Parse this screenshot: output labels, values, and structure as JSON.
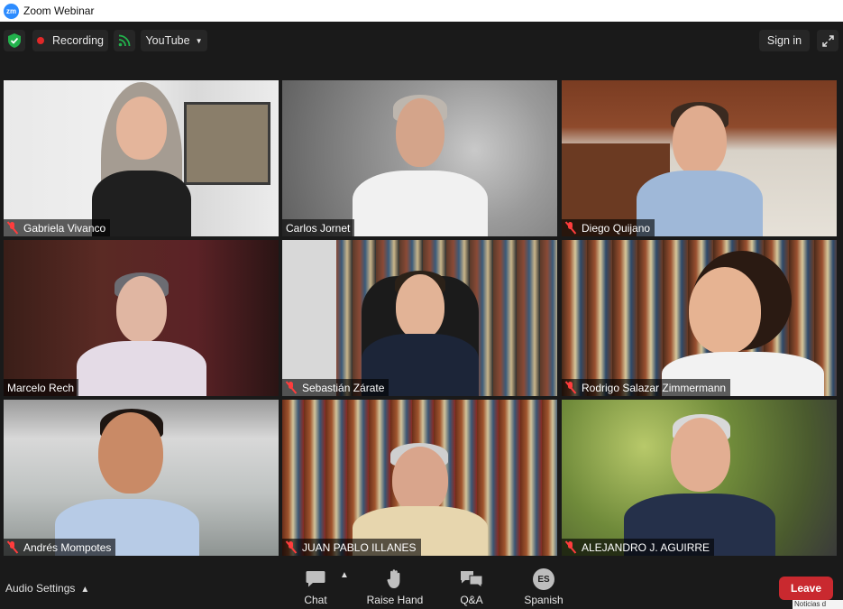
{
  "window": {
    "logo_text": "zm",
    "title": "Zoom Webinar"
  },
  "topbar": {
    "recording_label": "Recording",
    "stream_label": "YouTube",
    "sign_in_label": "Sign in"
  },
  "participants": [
    {
      "name": "Gabriela Vivanco",
      "muted": true,
      "active_speaker": false
    },
    {
      "name": "Carlos Jornet",
      "muted": false,
      "active_speaker": true
    },
    {
      "name": "Diego Quijano",
      "muted": true,
      "active_speaker": false
    },
    {
      "name": "Marcelo Rech",
      "muted": false,
      "active_speaker": false
    },
    {
      "name": "Sebastián Zárate",
      "muted": true,
      "active_speaker": false
    },
    {
      "name": "Rodrigo Salazar Zimmermann",
      "muted": true,
      "active_speaker": false
    },
    {
      "name": "Andrés Mompotes",
      "muted": true,
      "active_speaker": false
    },
    {
      "name": "JUAN PABLO ILLANES",
      "muted": true,
      "active_speaker": false
    },
    {
      "name": "ALEJANDRO J. AGUIRRE",
      "muted": true,
      "active_speaker": false
    }
  ],
  "bottombar": {
    "audio_settings_label": "Audio Settings",
    "chat_label": "Chat",
    "raise_hand_label": "Raise Hand",
    "qa_label": "Q&A",
    "language_badge": "ES",
    "language_label": "Spanish",
    "leave_label": "Leave"
  },
  "tooltip": {
    "text": "Noticias d"
  },
  "colors": {
    "active_speaker_border": "#e5f77b",
    "leave_button": "#c9292f",
    "recording_dot": "#e02828",
    "shield_green": "#22b24c",
    "muted_icon": "#ff3d3d"
  }
}
